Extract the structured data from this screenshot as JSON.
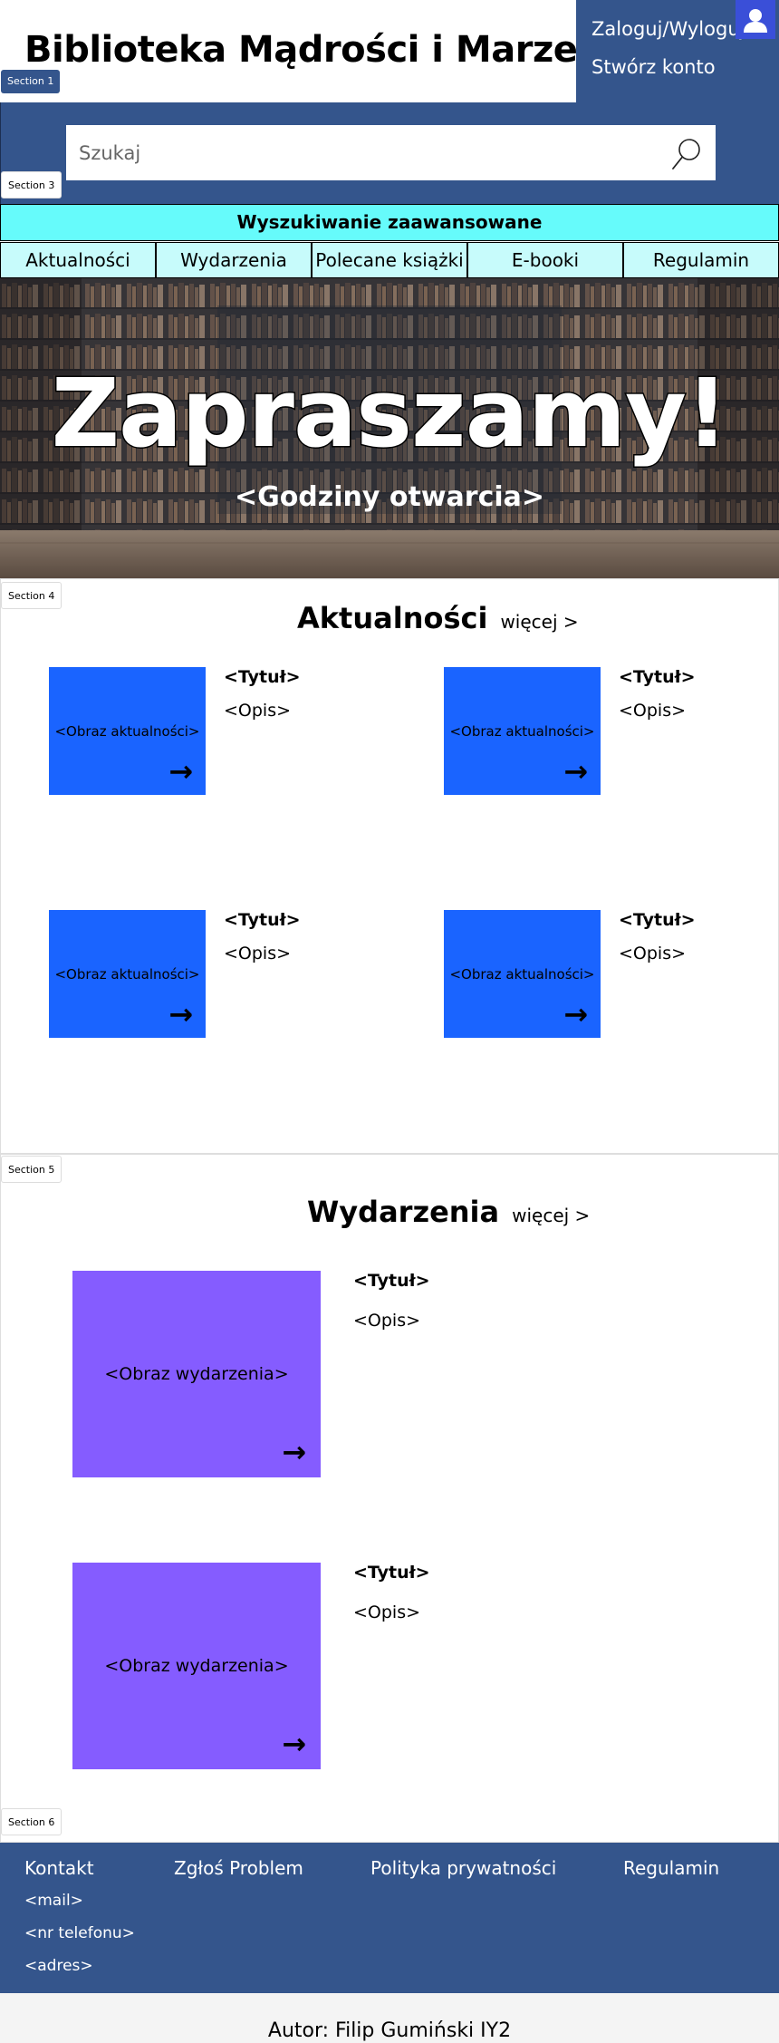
{
  "header": {
    "title": "Biblioteka Mądrości i Marzeń",
    "section_label": "Section 1",
    "login_label": "Zaloguj/Wyloguj",
    "register_label": "Stwórz konto",
    "avatar_icon": "user-icon"
  },
  "search": {
    "section_label": "Section 3",
    "placeholder": "Szukaj",
    "icon": "search-icon"
  },
  "nav": {
    "advanced_search": "Wyszukiwanie zaawansowane",
    "items": [
      "Aktualności",
      "Wydarzenia",
      "Polecane książki",
      "E-booki",
      "Regulamin"
    ]
  },
  "hero": {
    "title": "Zapraszamy!",
    "subtitle": "<Godziny otwarcia>"
  },
  "news": {
    "section_label": "Section 4",
    "heading": "Aktualności",
    "more": "więcej >",
    "cards": [
      {
        "image": "<Obraz aktualności>",
        "title": "<Tytuł>",
        "desc": "<Opis>",
        "arrow": "→"
      },
      {
        "image": "<Obraz aktualności>",
        "title": "<Tytuł>",
        "desc": "<Opis>",
        "arrow": "→"
      },
      {
        "image": "<Obraz aktualności>",
        "title": "<Tytuł>",
        "desc": "<Opis>",
        "arrow": "→"
      },
      {
        "image": "<Obraz aktualności>",
        "title": "<Tytuł>",
        "desc": "<Opis>",
        "arrow": "→"
      }
    ]
  },
  "events": {
    "section_label": "Section 5",
    "heading": "Wydarzenia",
    "more": "więcej >",
    "cards": [
      {
        "image": "<Obraz wydarzenia>",
        "title": "<Tytuł>",
        "desc": "<Opis>",
        "arrow": "→"
      },
      {
        "image": "<Obraz wydarzenia>",
        "title": "<Tytuł>",
        "desc": "<Opis>",
        "arrow": "→"
      }
    ]
  },
  "footer": {
    "section_label": "Section 6",
    "links": [
      "Kontakt",
      "Zgłoś Problem",
      "Polityka prywatności",
      "Regulamin"
    ],
    "contact": [
      "<mail>",
      "<nr telefonu>",
      "<adres>"
    ],
    "author": "Autor: Filip Gumiński IY2"
  },
  "colors": {
    "brand_blue": "#34558c",
    "cyan_bar": "#66fbfb",
    "cyan_nav": "#c7fbfb",
    "news_blue": "#1a64ff",
    "event_purple": "#855cff"
  }
}
